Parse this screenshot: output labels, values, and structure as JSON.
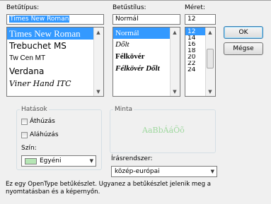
{
  "font": {
    "label": "Betűtípus:",
    "value": "Times New Roman",
    "items": [
      "Times New Roman",
      "Trebuchet MS",
      "Tw Cen MT",
      "Verdana",
      "Viner Hand ITC"
    ]
  },
  "style": {
    "label": "Betűstílus:",
    "value": "Normál",
    "items": [
      "Normál",
      "Dőlt",
      "Félkövér",
      "Félkövér Dőlt"
    ]
  },
  "size": {
    "label": "Méret:",
    "value": "12",
    "items": [
      "12",
      "14",
      "16",
      "18",
      "20",
      "22",
      "24"
    ]
  },
  "buttons": {
    "ok": "OK",
    "cancel": "Mégse"
  },
  "effects": {
    "title": "Hatások",
    "strikeout": "Áthúzás",
    "underline": "Aláhúzás",
    "color_label": "Szín:",
    "color_value": "Egyéni",
    "color_swatch": "#b5e6b5"
  },
  "sample": {
    "title": "Minta",
    "text": "AaBbÁáÕõ",
    "color": "#9fd89f"
  },
  "script": {
    "label": "Írásrendszer:",
    "value": "közép-európai"
  },
  "description": "Ez egy OpenType betűkészlet. Ugyanez a betűkészlet jelenik meg a nyomtatásban és a képernyőn.",
  "colors": {
    "selection": "#3399ff",
    "border": "#7a7a7a"
  }
}
